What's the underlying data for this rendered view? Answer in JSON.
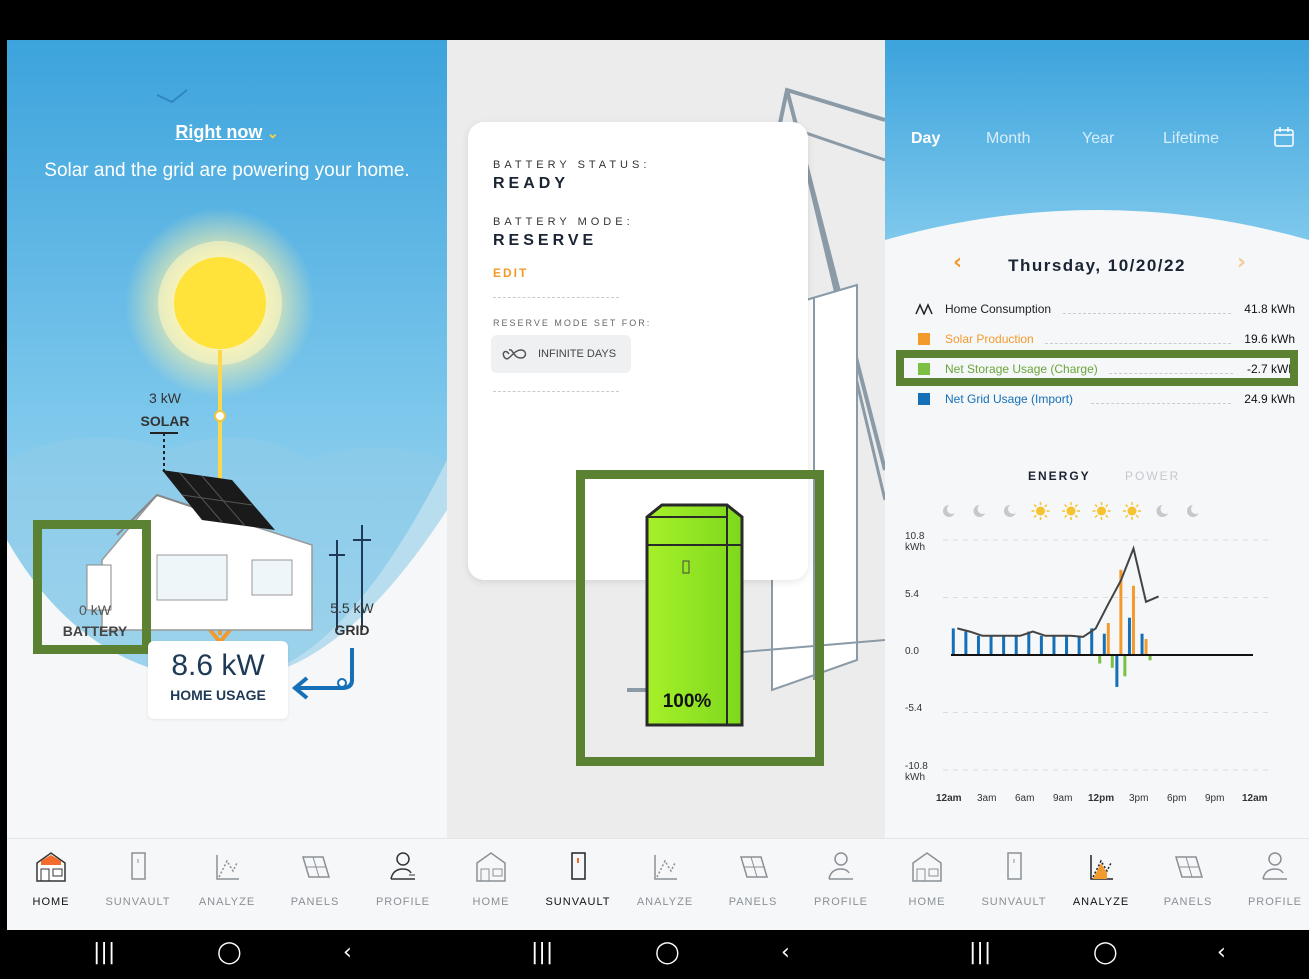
{
  "home": {
    "right_now": "Right now",
    "status_text": "Solar and the grid are powering your home.",
    "solar_value": "3 kW",
    "solar_label": "SOLAR",
    "battery_value": "0 kW",
    "battery_label": "BATTERY",
    "grid_value": "5.5 kW",
    "grid_label": "GRID",
    "home_usage_value": "8.6 kW",
    "home_usage_label": "HOME USAGE"
  },
  "sunvault": {
    "battery_status_label": "BATTERY STATUS:",
    "battery_status_value": "READY",
    "battery_mode_label": "BATTERY MODE:",
    "battery_mode_value": "RESERVE",
    "edit_label": "EDIT",
    "reserve_set_for_label": "RESERVE MODE SET FOR:",
    "reserve_duration": "INFINITE DAYS",
    "battery_percent_text": "100%",
    "battery_percent": 100
  },
  "analyze": {
    "tabs": [
      "Day",
      "Month",
      "Year",
      "Lifetime"
    ],
    "active_tab": "Day",
    "date": "Thursday, 10/20/22",
    "legend": [
      {
        "label": "Home Consumption",
        "value": "41.8 kWh",
        "color": "#222222",
        "icon": "line-icon"
      },
      {
        "label": "Solar Production",
        "value": "19.6 kWh",
        "color": "#f39a2d",
        "icon": "square"
      },
      {
        "label": "Net Storage Usage (Charge)",
        "value": "-2.7 kWh",
        "color": "#7bc043",
        "icon": "square"
      },
      {
        "label": "Net Grid Usage (Import)",
        "value": "24.9 kWh",
        "color": "#1570b8",
        "icon": "square"
      }
    ],
    "energy_label": "ENERGY",
    "power_label": "POWER",
    "weather_icons": [
      "moon",
      "moon",
      "moon",
      "sun",
      "sun",
      "sun",
      "sun",
      "moon",
      "moon"
    ]
  },
  "chart_data": {
    "type": "bar",
    "y_tick_labels": [
      "10.8\nkWh",
      "5.4",
      "0.0",
      "-5.4",
      "-10.8\nkWh"
    ],
    "ylim": [
      -10.8,
      10.8
    ],
    "x_tick_labels": [
      "12am",
      "3am",
      "6am",
      "9am",
      "12pm",
      "3pm",
      "6pm",
      "9pm",
      "12am"
    ],
    "x_hours": [
      0,
      1,
      2,
      3,
      4,
      5,
      6,
      7,
      8,
      9,
      10,
      11,
      12,
      13,
      14,
      15,
      16,
      17,
      18,
      19,
      20,
      21,
      22,
      23
    ],
    "series": [
      {
        "name": "Home Consumption",
        "type": "line",
        "values": [
          2.5,
          2.2,
          1.8,
          1.8,
          1.8,
          1.8,
          2.2,
          1.8,
          1.8,
          1.8,
          1.7,
          2.5,
          4.8,
          7.0,
          10.0,
          5.0,
          5.5,
          0,
          0,
          0,
          0,
          0,
          0,
          0
        ]
      },
      {
        "name": "Solar Production",
        "type": "bar",
        "values": [
          0,
          0,
          0,
          0,
          0,
          0,
          0,
          0,
          0,
          0,
          0,
          0,
          3.0,
          8.0,
          6.5,
          1.5,
          0,
          0,
          0,
          0,
          0,
          0,
          0,
          0
        ]
      },
      {
        "name": "Net Storage Usage (Charge)",
        "type": "bar",
        "values": [
          0,
          0,
          0,
          0,
          0,
          0,
          0,
          0,
          0,
          0,
          0,
          -0.8,
          -1.2,
          -2.0,
          0,
          -0.5,
          0,
          0,
          0,
          0,
          0,
          0,
          0,
          0
        ]
      },
      {
        "name": "Net Grid Usage (Import)",
        "type": "bar",
        "values": [
          2.5,
          2.2,
          1.8,
          1.8,
          1.8,
          1.8,
          2.2,
          1.8,
          1.8,
          1.8,
          1.7,
          2.5,
          2.0,
          -3.0,
          3.5,
          2.0,
          0,
          0,
          0,
          0,
          0,
          0,
          0,
          0
        ]
      }
    ]
  },
  "nav": {
    "items": [
      "HOME",
      "SUNVAULT",
      "ANALYZE",
      "PANELS",
      "PROFILE"
    ]
  },
  "colors": {
    "accent_orange": "#f39a2d",
    "sky_blue": "#4aaee0",
    "highlight_green": "#5a8232",
    "battery_green": "#8ee02a",
    "grid_blue": "#1570b8"
  }
}
